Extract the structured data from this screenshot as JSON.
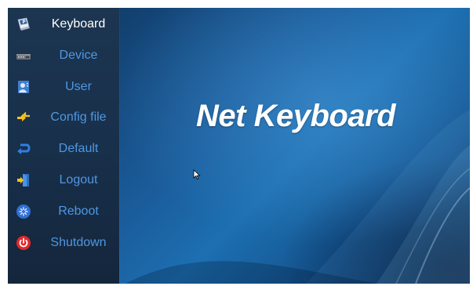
{
  "menu": {
    "items": [
      {
        "label": "Keyboard",
        "icon": "keyboard-app-icon",
        "active": true
      },
      {
        "label": "Device",
        "icon": "device-icon",
        "active": false
      },
      {
        "label": "User",
        "icon": "user-icon",
        "active": false
      },
      {
        "label": "Config file",
        "icon": "config-file-icon",
        "active": false
      },
      {
        "label": "Default",
        "icon": "default-reset-icon",
        "active": false
      },
      {
        "label": "Logout",
        "icon": "logout-icon",
        "active": false
      },
      {
        "label": "Reboot",
        "icon": "reboot-icon",
        "active": false
      },
      {
        "label": "Shutdown",
        "icon": "shutdown-icon",
        "active": false
      }
    ]
  },
  "main": {
    "title": "Net Keyboard"
  },
  "colors": {
    "menu_text": "#4f97e3",
    "menu_text_active": "#ffffff",
    "sidebar_bg": "#18304b",
    "background_accent": "#1c6fb1",
    "shutdown_red": "#e0292c"
  }
}
